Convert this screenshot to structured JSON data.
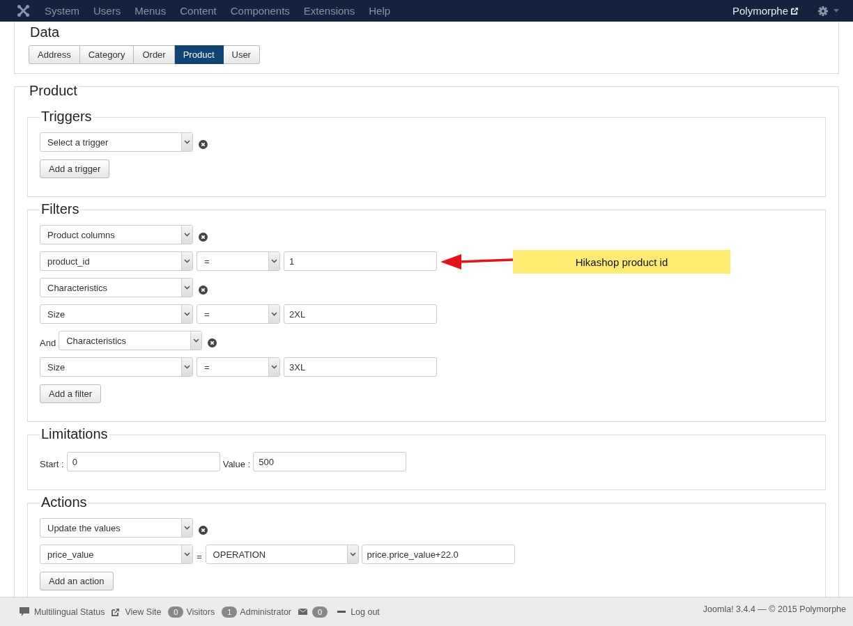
{
  "topbar": {
    "menu": [
      "System",
      "Users",
      "Menus",
      "Content",
      "Components",
      "Extensions",
      "Help"
    ],
    "user": "Polymorphe"
  },
  "data_section": {
    "title": "Data",
    "tabs": [
      {
        "label": "Address",
        "selected": false
      },
      {
        "label": "Category",
        "selected": false
      },
      {
        "label": "Order",
        "selected": false
      },
      {
        "label": "Product",
        "selected": true
      },
      {
        "label": "User",
        "selected": false
      }
    ]
  },
  "product": {
    "title": "Product",
    "groups": [
      {
        "title": "Triggers",
        "rows": [
          {
            "kind": "select",
            "value": "Select a trigger"
          },
          {
            "kind": "button",
            "label": "Add a trigger"
          }
        ]
      },
      {
        "title": "Filters",
        "rows": [
          {
            "kind": "select",
            "value": "Product columns"
          },
          {
            "kind": "condition",
            "field": "product_id",
            "operator": "=",
            "value": "1",
            "callout": "Hikashop product id"
          },
          {
            "kind": "select",
            "value": "Characteristics"
          },
          {
            "kind": "condition",
            "field": "Size",
            "operator": "=",
            "value": "2XL"
          },
          {
            "kind": "select",
            "prefix": "And",
            "value": "Characteristics"
          },
          {
            "kind": "condition",
            "field": "Size",
            "operator": "=",
            "value": "3XL"
          },
          {
            "kind": "button",
            "label": "Add a filter"
          }
        ]
      },
      {
        "title": "Limitations",
        "rows": [
          {
            "kind": "range",
            "fields": [
              {
                "label": "Start :",
                "value": "0"
              },
              {
                "label": "Value :",
                "value": "500"
              }
            ]
          }
        ]
      },
      {
        "title": "Actions",
        "rows": [
          {
            "kind": "select",
            "value": "Update the values"
          },
          {
            "kind": "assignment",
            "field": "price_value",
            "sign": "=",
            "mode": "OPERATION",
            "value": "price.price_value+22.0"
          },
          {
            "kind": "button",
            "label": "Add an action"
          }
        ]
      }
    ]
  },
  "status_bar": {
    "items": [
      {
        "kind": "multilingual",
        "label": "Multilingual Status"
      },
      {
        "kind": "view-site",
        "label": "View Site"
      },
      {
        "kind": "count",
        "count": "0",
        "label": "Visitors"
      },
      {
        "kind": "count",
        "count": "1",
        "label": "Administrator"
      },
      {
        "kind": "messages",
        "count": "0"
      },
      {
        "kind": "logout",
        "label": "Log out"
      }
    ],
    "copyright": "Joomla! 3.4.4 — © 2015 Polymorphe"
  }
}
